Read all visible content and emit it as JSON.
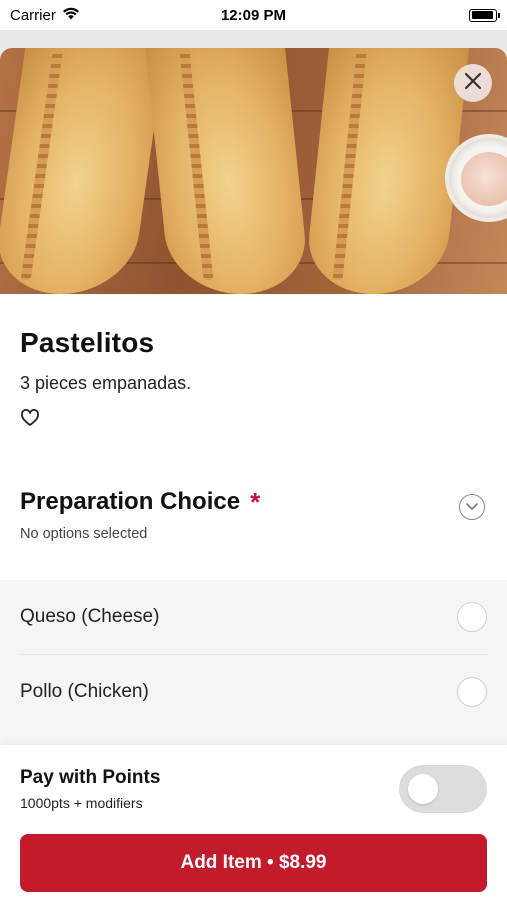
{
  "status_bar": {
    "carrier": "Carrier",
    "time": "12:09 PM"
  },
  "item": {
    "title": "Pastelitos",
    "description": "3 pieces empanadas."
  },
  "preparation": {
    "title": "Preparation Choice",
    "required_marker": "*",
    "subtitle": "No options selected",
    "options": [
      {
        "label": "Queso (Cheese)",
        "selected": false
      },
      {
        "label": "Pollo (Chicken)",
        "selected": false
      }
    ]
  },
  "points": {
    "title": "Pay with Points",
    "subtitle": "1000pts + modifiers",
    "enabled": false
  },
  "add_button": {
    "label": "Add Item • $8.99"
  },
  "colors": {
    "accent": "#c11b2c",
    "required": "#c0143c"
  },
  "icons": [
    "wifi-icon",
    "battery-icon",
    "close-icon",
    "heart-icon",
    "chevron-down-icon"
  ]
}
